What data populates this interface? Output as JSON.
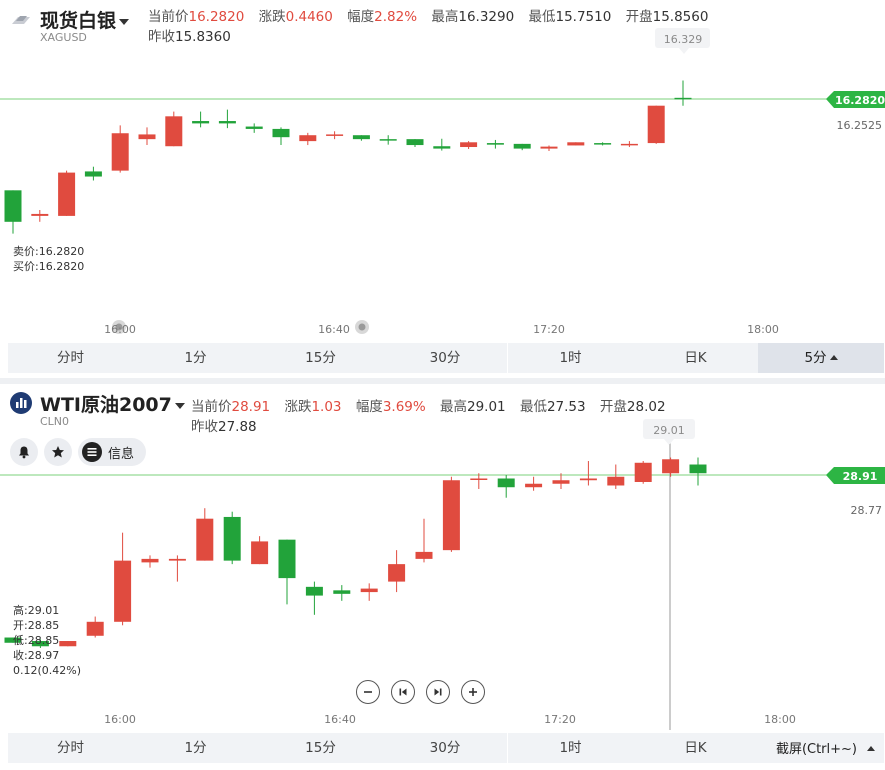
{
  "colors": {
    "up": "#e04b3f",
    "down": "#22a33a",
    "price_line": "#7bd17b",
    "badge": "#2db544"
  },
  "panel1": {
    "icon": "silver-ingot-icon",
    "title": "现货白银",
    "code": "XAGUSD",
    "quote": {
      "current_label": "当前价",
      "current": "16.2820",
      "change_label": "涨跌",
      "change": "0.4460",
      "range_label": "幅度",
      "range": "2.82%",
      "high_label": "最高",
      "high": "16.3290",
      "low_label": "最低",
      "low": "15.7510",
      "open_label": "开盘",
      "open": "15.8560",
      "prev_label": "昨收",
      "prev": "15.8360"
    },
    "sell_label": "卖价:16.2820",
    "buy_label": "买价:16.2820",
    "high_marker": "16.329",
    "price_badge": "16.2820",
    "side_price": "16.2525",
    "time_labels": [
      "16:00",
      "16:40",
      "17:20",
      "18:00"
    ],
    "tabs": [
      "分时",
      "1分",
      "15分",
      "30分",
      "1时",
      "日K",
      "5分"
    ],
    "active_tab": "5分"
  },
  "panel2": {
    "icon": "oil-bars-icon",
    "title": "WTI原油2007",
    "code": "CLN0",
    "quote": {
      "current_label": "当前价",
      "current": "28.91",
      "change_label": "涨跌",
      "change": "1.03",
      "range_label": "幅度",
      "range": "3.69%",
      "high_label": "最高",
      "high": "29.01",
      "low_label": "最低",
      "low": "27.53",
      "open_label": "开盘",
      "open": "28.02",
      "prev_label": "昨收",
      "prev": "27.88"
    },
    "info_label": "信息",
    "ohlc": [
      "高:29.01",
      "开:28.85",
      "低:28.85",
      "收:28.97",
      "0.12(0.42%)"
    ],
    "high_marker": "29.01",
    "price_badge": "28.91",
    "side_price": "28.77",
    "time_labels": [
      "16:00",
      "16:40",
      "17:20",
      "18:00"
    ],
    "tabs": [
      "分时",
      "1分",
      "15分",
      "30分",
      "1时",
      "日K"
    ],
    "screenshot_label": "截屏(Ctrl+~)"
  },
  "chart_data": [
    {
      "type": "candlestick",
      "series": "现货白银 5分",
      "x": [
        "16:00",
        "16:40",
        "17:20",
        "18:00"
      ],
      "candles": [
        {
          "o": 16.05,
          "c": 15.97,
          "h": 16.05,
          "l": 15.94
        },
        {
          "o": 15.985,
          "c": 15.99,
          "h": 16.0,
          "l": 15.97
        },
        {
          "o": 15.985,
          "c": 16.095,
          "h": 16.1,
          "l": 15.985
        },
        {
          "o": 16.098,
          "c": 16.085,
          "h": 16.11,
          "l": 16.075
        },
        {
          "o": 16.1,
          "c": 16.195,
          "h": 16.215,
          "l": 16.095
        },
        {
          "o": 16.18,
          "c": 16.192,
          "h": 16.21,
          "l": 16.165
        },
        {
          "o": 16.162,
          "c": 16.238,
          "h": 16.25,
          "l": 16.162
        },
        {
          "o": 16.226,
          "c": 16.22,
          "h": 16.25,
          "l": 16.21
        },
        {
          "o": 16.226,
          "c": 16.22,
          "h": 16.255,
          "l": 16.208
        },
        {
          "o": 16.212,
          "c": 16.206,
          "h": 16.22,
          "l": 16.196
        },
        {
          "o": 16.206,
          "c": 16.185,
          "h": 16.21,
          "l": 16.165
        },
        {
          "o": 16.175,
          "c": 16.19,
          "h": 16.196,
          "l": 16.165
        },
        {
          "o": 16.19,
          "c": 16.192,
          "h": 16.2,
          "l": 16.18
        },
        {
          "o": 16.19,
          "c": 16.18,
          "h": 16.19,
          "l": 16.176
        },
        {
          "o": 16.18,
          "c": 16.179,
          "h": 16.19,
          "l": 16.166
        },
        {
          "o": 16.18,
          "c": 16.165,
          "h": 16.18,
          "l": 16.16
        },
        {
          "o": 16.162,
          "c": 16.156,
          "h": 16.181,
          "l": 16.151
        },
        {
          "o": 16.16,
          "c": 16.172,
          "h": 16.175,
          "l": 16.155
        },
        {
          "o": 16.17,
          "c": 16.166,
          "h": 16.178,
          "l": 16.156
        },
        {
          "o": 16.168,
          "c": 16.156,
          "h": 16.168,
          "l": 16.152
        },
        {
          "o": 16.156,
          "c": 16.161,
          "h": 16.164,
          "l": 16.15
        },
        {
          "o": 16.164,
          "c": 16.172,
          "h": 16.172,
          "l": 16.164
        },
        {
          "o": 16.17,
          "c": 16.168,
          "h": 16.172,
          "l": 16.164
        },
        {
          "o": 16.166,
          "c": 16.168,
          "h": 16.175,
          "l": 16.16
        },
        {
          "o": 16.17,
          "c": 16.265,
          "h": 16.265,
          "l": 16.168
        },
        {
          "o": 16.285,
          "c": 16.282,
          "h": 16.329,
          "l": 16.265
        }
      ]
    },
    {
      "type": "candlestick",
      "series": "WTI原油2007 5分",
      "x": [
        "16:00",
        "16:40",
        "17:20",
        "18:00"
      ],
      "candles": [
        {
          "o": 27.98,
          "c": 27.95,
          "h": 27.98,
          "l": 27.95
        },
        {
          "o": 27.96,
          "c": 27.93,
          "h": 27.97,
          "l": 27.92
        },
        {
          "o": 27.93,
          "c": 27.96,
          "h": 27.96,
          "l": 27.93
        },
        {
          "o": 27.99,
          "c": 28.07,
          "h": 28.1,
          "l": 27.98
        },
        {
          "o": 28.07,
          "c": 28.42,
          "h": 28.58,
          "l": 28.05
        },
        {
          "o": 28.41,
          "c": 28.43,
          "h": 28.45,
          "l": 28.38
        },
        {
          "o": 28.42,
          "c": 28.43,
          "h": 28.45,
          "l": 28.3
        },
        {
          "o": 28.42,
          "c": 28.66,
          "h": 28.72,
          "l": 28.42
        },
        {
          "o": 28.67,
          "c": 28.42,
          "h": 28.7,
          "l": 28.4
        },
        {
          "o": 28.4,
          "c": 28.53,
          "h": 28.56,
          "l": 28.4
        },
        {
          "o": 28.54,
          "c": 28.32,
          "h": 28.54,
          "l": 28.17
        },
        {
          "o": 28.27,
          "c": 28.22,
          "h": 28.3,
          "l": 28.11
        },
        {
          "o": 28.25,
          "c": 28.23,
          "h": 28.28,
          "l": 28.19
        },
        {
          "o": 28.24,
          "c": 28.26,
          "h": 28.29,
          "l": 28.19
        },
        {
          "o": 28.3,
          "c": 28.4,
          "h": 28.48,
          "l": 28.24
        },
        {
          "o": 28.43,
          "c": 28.47,
          "h": 28.66,
          "l": 28.41
        },
        {
          "o": 28.48,
          "c": 28.88,
          "h": 28.9,
          "l": 28.47
        },
        {
          "o": 28.89,
          "c": 28.89,
          "h": 28.92,
          "l": 28.83
        },
        {
          "o": 28.89,
          "c": 28.84,
          "h": 28.91,
          "l": 28.78
        },
        {
          "o": 28.84,
          "c": 28.86,
          "h": 28.9,
          "l": 28.82
        },
        {
          "o": 28.86,
          "c": 28.88,
          "h": 28.92,
          "l": 28.83
        },
        {
          "o": 28.88,
          "c": 28.89,
          "h": 28.99,
          "l": 28.85
        },
        {
          "o": 28.85,
          "c": 28.9,
          "h": 28.97,
          "l": 28.83
        },
        {
          "o": 28.87,
          "c": 28.98,
          "h": 28.99,
          "l": 28.86
        },
        {
          "o": 28.92,
          "c": 29.0,
          "h": 29.01,
          "l": 28.9
        },
        {
          "o": 28.97,
          "c": 28.92,
          "h": 29.01,
          "l": 28.85
        }
      ]
    }
  ]
}
